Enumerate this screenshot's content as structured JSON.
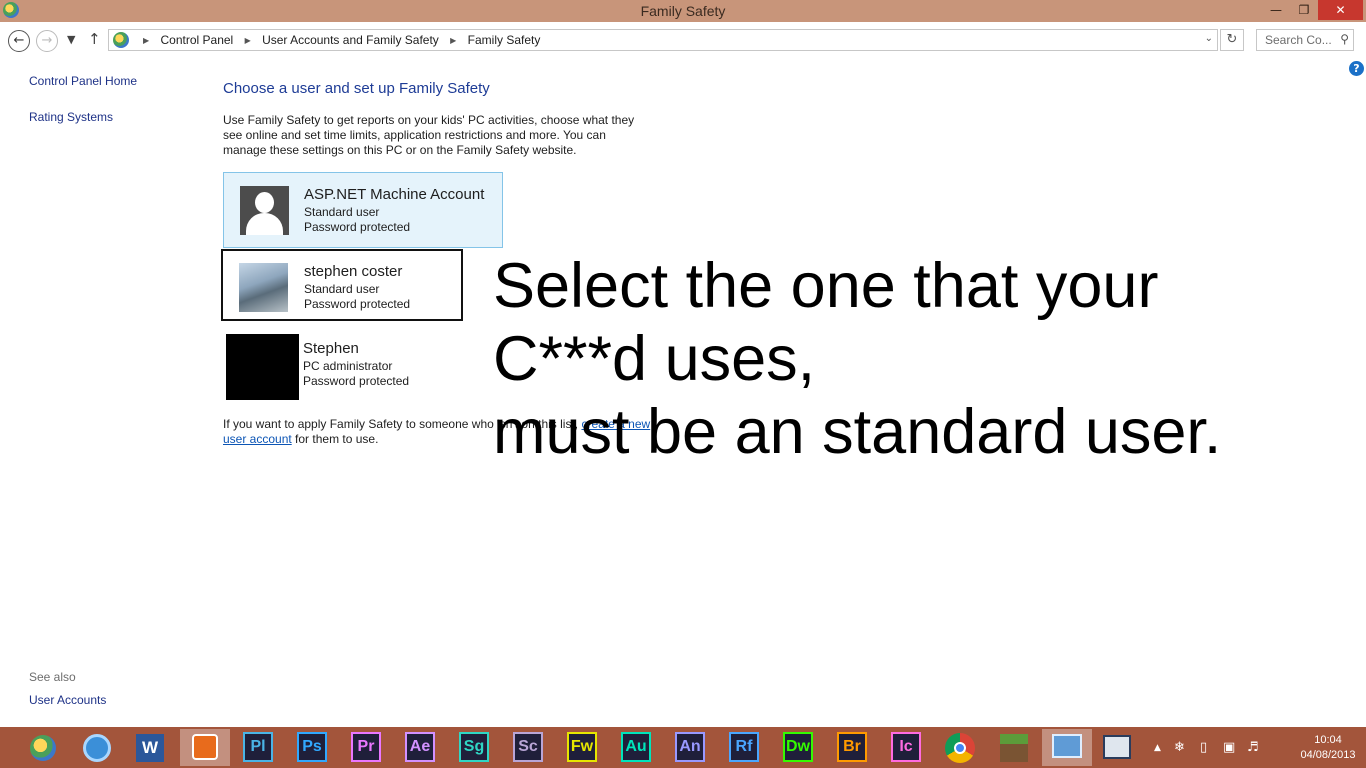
{
  "window": {
    "title": "Family Safety"
  },
  "address": {
    "crumbs": [
      "Control Panel",
      "User Accounts and Family Safety",
      "Family Safety"
    ],
    "search_placeholder": "Search Co..."
  },
  "sidebar": {
    "links": [
      "Control Panel Home",
      "Rating Systems"
    ],
    "see_also_label": "See also",
    "see_also_links": [
      "User Accounts"
    ]
  },
  "main": {
    "heading": "Choose a user and set up Family Safety",
    "description": "Use Family Safety to get reports on your kids' PC activities, choose what they see online and set time limits, application restrictions and more. You can manage these settings on this PC or on the Family Safety website.",
    "users": [
      {
        "name": "ASP.NET Machine Account",
        "role": "Standard user",
        "status": "Password protected"
      },
      {
        "name": "stephen coster",
        "role": "Standard user",
        "status": "Password protected"
      },
      {
        "name": "Stephen",
        "role": "PC administrator",
        "status": "Password protected"
      }
    ],
    "footnote_before": "If you want to apply Family Safety to someone who isn't on this list, ",
    "footnote_link": "create a new user account",
    "footnote_after": " for them to use."
  },
  "overlay_text": "Select the one that your\nC***d uses,\nmust be an standard user.",
  "taskbar": {
    "adobe_apps": [
      {
        "label": "Pl",
        "color": "#4ab4e6"
      },
      {
        "label": "Ps",
        "color": "#31a8ff"
      },
      {
        "label": "Pr",
        "color": "#ea77ff"
      },
      {
        "label": "Ae",
        "color": "#d291ff"
      },
      {
        "label": "Sg",
        "color": "#2fd6c4"
      },
      {
        "label": "Sc",
        "color": "#b9a5d6"
      },
      {
        "label": "Fw",
        "color": "#e6e600"
      },
      {
        "label": "Au",
        "color": "#00e4bb"
      },
      {
        "label": "An",
        "color": "#9999ff"
      },
      {
        "label": "Rf",
        "color": "#4aa6ff"
      },
      {
        "label": "Dw",
        "color": "#35fa00"
      },
      {
        "label": "Br",
        "color": "#ff9a00"
      },
      {
        "label": "Ic",
        "color": "#ff6be0"
      }
    ],
    "time": "10:04",
    "date": "04/08/2013"
  }
}
